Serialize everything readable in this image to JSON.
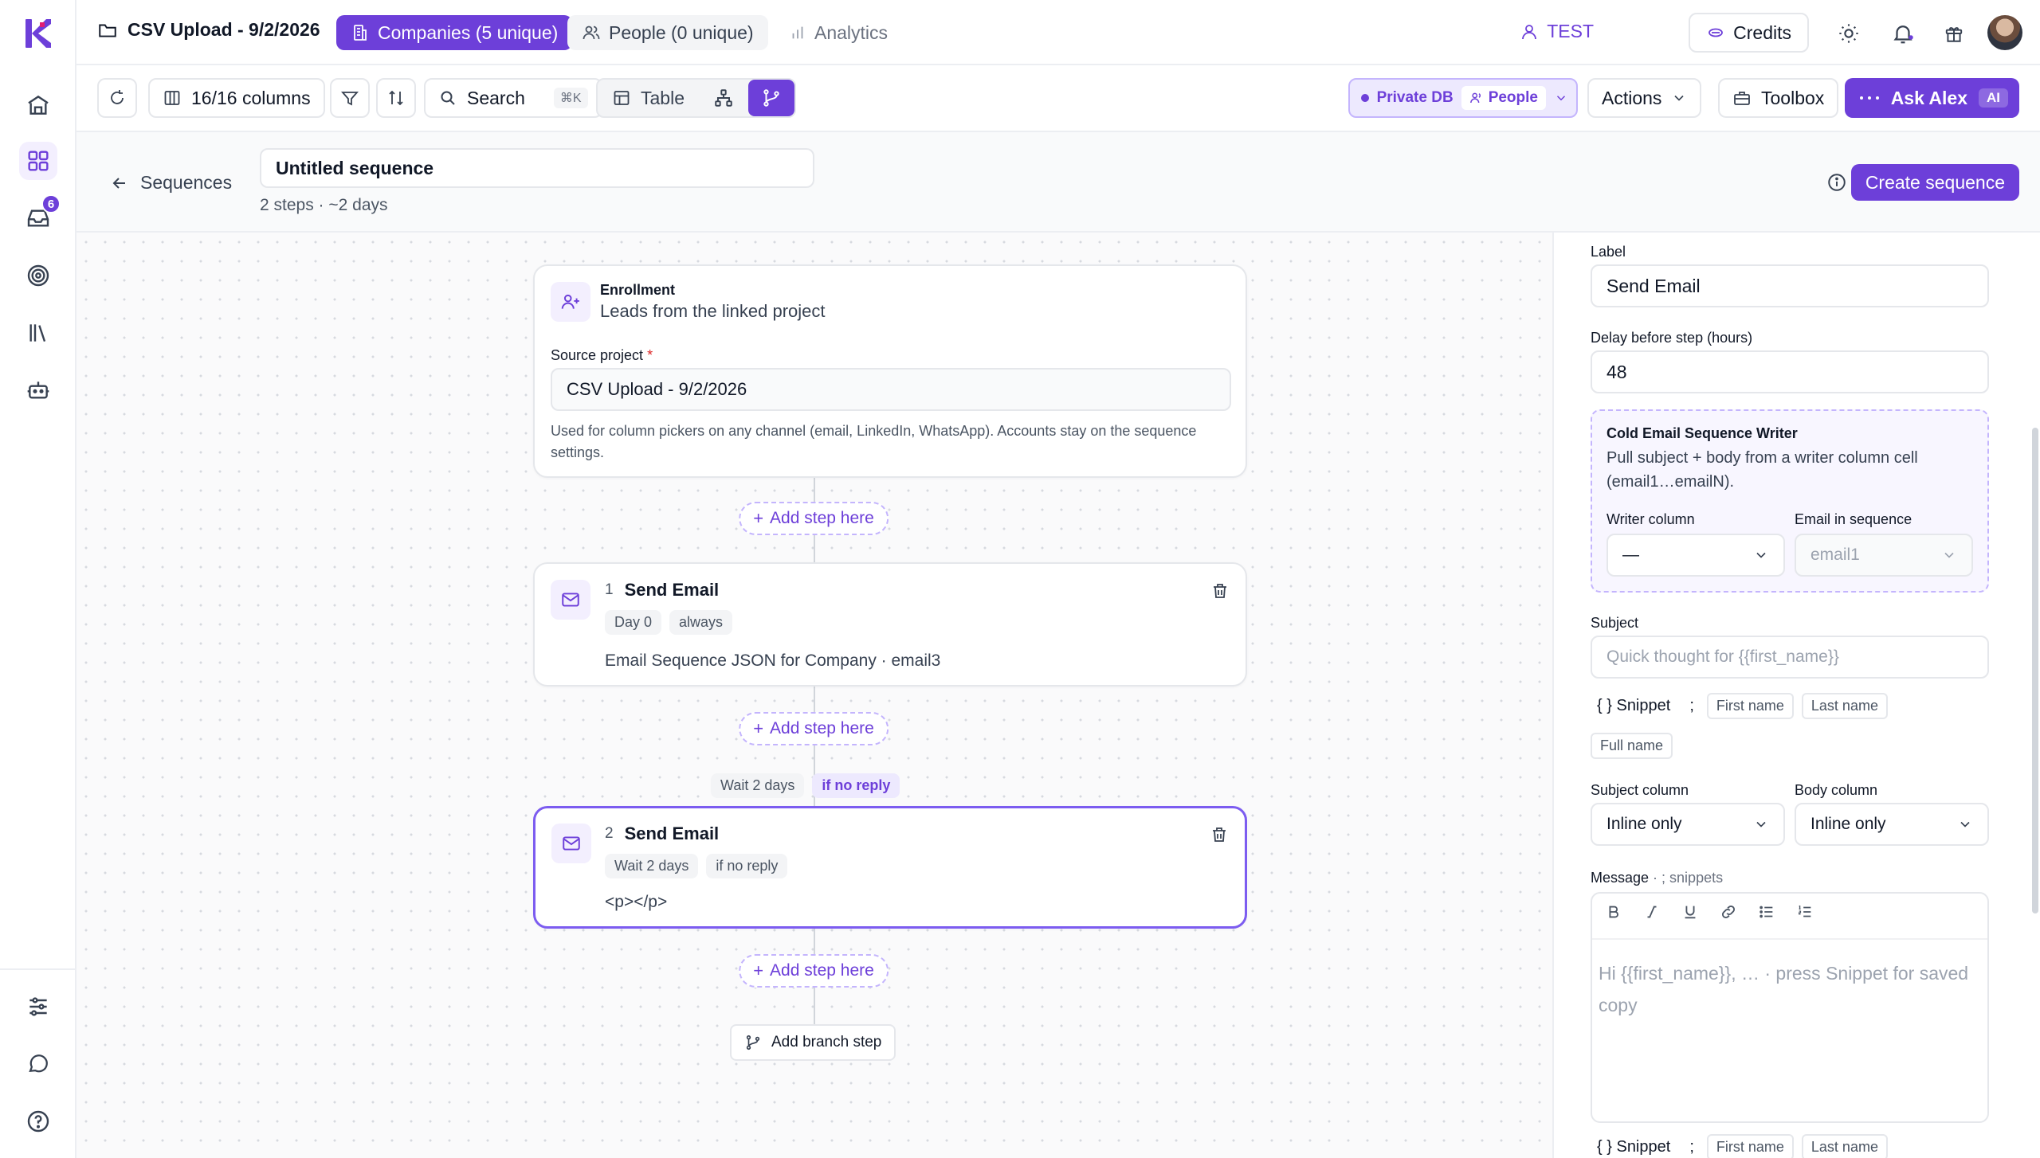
{
  "colors": {
    "accent": "#6d3fd9",
    "accent_light": "#ede9fe",
    "border": "#e5e7eb"
  },
  "rail": {
    "logo_letter": "K",
    "items": [
      {
        "name": "home-icon"
      },
      {
        "name": "grid-icon"
      },
      {
        "name": "inbox-icon",
        "badge": "6"
      },
      {
        "name": "target-icon"
      },
      {
        "name": "library-icon"
      },
      {
        "name": "bot-icon"
      },
      {
        "name": "sliders-icon"
      },
      {
        "name": "chat-icon"
      },
      {
        "name": "help-icon"
      }
    ]
  },
  "topbar": {
    "title": "CSV Upload - 9/2/2026",
    "tabs": {
      "companies": "Companies (5 unique)",
      "people": "People (0 unique)",
      "analytics": "Analytics"
    },
    "test_label": "TEST",
    "credits_label": "Credits"
  },
  "toolbar": {
    "columns_label": "16/16 columns",
    "search_label": "Search",
    "search_shortcut": "⌘K",
    "table_label": "Table",
    "db_label": "Private DB",
    "db_people_label": "People",
    "actions_label": "Actions",
    "toolbox_label": "Toolbox",
    "ask_label": "Ask Alex",
    "ai_label": "AI"
  },
  "sequence": {
    "back_label": "Sequences",
    "name_value": "Untitled sequence",
    "meta": "2 steps · ~2 days",
    "create_label": "Create sequence"
  },
  "canvas": {
    "enrollment": {
      "title": "Enrollment",
      "subtitle": "Leads from the linked project",
      "source_label": "Source project",
      "required_mark": "*",
      "source_value": "CSV Upload - 9/2/2026",
      "help_text": "Used for column pickers on any channel (email, LinkedIn, WhatsApp). Accounts stay on the sequence settings."
    },
    "add_step_label": "Add step here",
    "steps": [
      {
        "num": "1",
        "title": "Send Email",
        "chips": [
          "Day 0",
          "always"
        ],
        "detail": "Email Sequence JSON for Company · email3"
      },
      {
        "num": "2",
        "title": "Send Email",
        "chips": [
          "Wait 2 days",
          "if no reply"
        ],
        "detail": "<p></p>"
      }
    ],
    "between": {
      "wait": "Wait 2 days",
      "condition": "if no reply"
    },
    "branch_label": "Add branch step"
  },
  "panel": {
    "label_label": "Label",
    "label_value": "Send Email",
    "delay_label": "Delay before step (hours)",
    "delay_value": "48",
    "writer": {
      "title": "Cold Email Sequence Writer",
      "desc": "Pull subject + body from a writer column cell (email1…emailN).",
      "column_label": "Writer column",
      "column_value": "—",
      "seq_label": "Email in sequence",
      "seq_value": "email1"
    },
    "subject_label": "Subject",
    "subject_placeholder": "Quick thought for {{first_name}}",
    "snippet_label": "{ } Snippet",
    "snippet_sep": ";",
    "snippet_chips": [
      "First name",
      "Last name",
      "Full name"
    ],
    "subject_column_label": "Subject column",
    "subject_column_value": "Inline only",
    "body_column_label": "Body column",
    "body_column_value": "Inline only",
    "message_label": "Message",
    "message_hint": " · ; snippets",
    "message_placeholder": "Hi {{first_name}}, …  ·  press Snippet for saved copy"
  }
}
